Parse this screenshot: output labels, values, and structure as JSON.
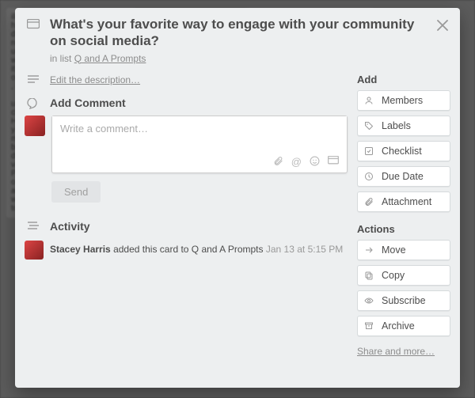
{
  "card": {
    "title": "What's your favorite way to engage with your community on social media?",
    "in_list_label": "in list",
    "list_name": "Q and A Prompts",
    "edit_description_label": "Edit the description…"
  },
  "comment": {
    "heading": "Add Comment",
    "placeholder": "Write a comment…",
    "send_label": "Send"
  },
  "activity": {
    "heading": "Activity",
    "items": [
      {
        "user": "Stacey Harris",
        "text": "added this card to Q and A Prompts",
        "timestamp": "Jan 13 at 5:15 PM"
      }
    ]
  },
  "sidebar": {
    "add": {
      "heading": "Add",
      "buttons": [
        {
          "icon": "members-icon",
          "label": "Members"
        },
        {
          "icon": "labels-icon",
          "label": "Labels"
        },
        {
          "icon": "checklist-icon",
          "label": "Checklist"
        },
        {
          "icon": "due-date-icon",
          "label": "Due Date"
        },
        {
          "icon": "attachment-icon",
          "label": "Attachment"
        }
      ]
    },
    "actions": {
      "heading": "Actions",
      "buttons": [
        {
          "icon": "move-icon",
          "label": "Move"
        },
        {
          "icon": "copy-icon",
          "label": "Copy"
        },
        {
          "icon": "subscribe-icon",
          "label": "Subscribe"
        },
        {
          "icon": "archive-icon",
          "label": "Archive"
        }
      ]
    },
    "share_label": "Share and more…"
  }
}
